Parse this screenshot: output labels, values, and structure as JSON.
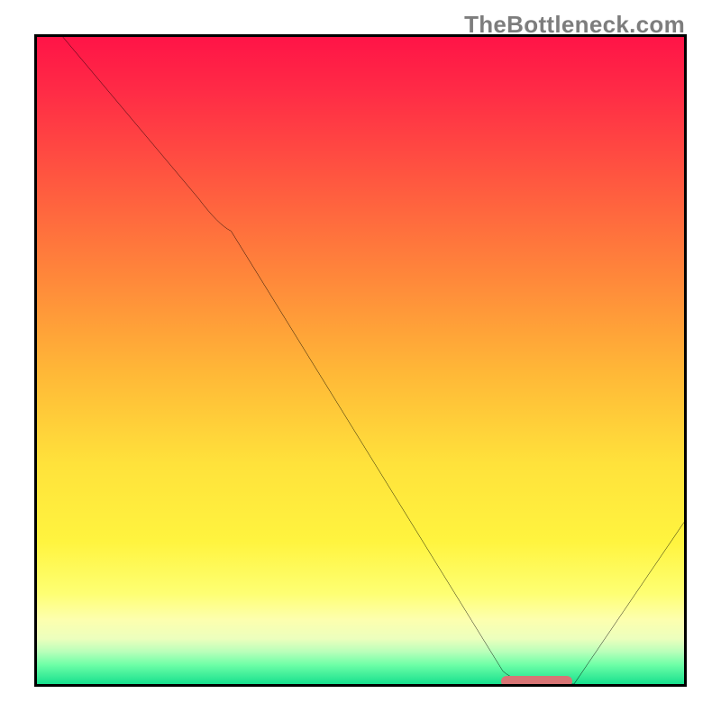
{
  "watermark_text": "TheBottleneck.com",
  "colors": {
    "gradient_top": "#ff1447",
    "gradient_mid1": "#ff8a3a",
    "gradient_mid2": "#ffe23b",
    "gradient_bottom": "#17e08e",
    "curve_stroke": "#000000",
    "marker_fill": "#d87575",
    "frame_border": "#000000"
  },
  "chart_data": {
    "type": "line",
    "title": "",
    "xlabel": "",
    "ylabel": "",
    "xlim": [
      0,
      100
    ],
    "ylim": [
      0,
      100
    ],
    "series": [
      {
        "name": "bottleneck-curve",
        "x": [
          4,
          25,
          30,
          72,
          78,
          83,
          100
        ],
        "values": [
          100,
          75,
          70,
          2,
          0,
          0,
          25
        ]
      }
    ],
    "annotations": [
      {
        "name": "optimum-marker",
        "shape": "pill",
        "x_start": 72,
        "x_end": 83,
        "y": 0,
        "color": "#d87575"
      }
    ]
  }
}
